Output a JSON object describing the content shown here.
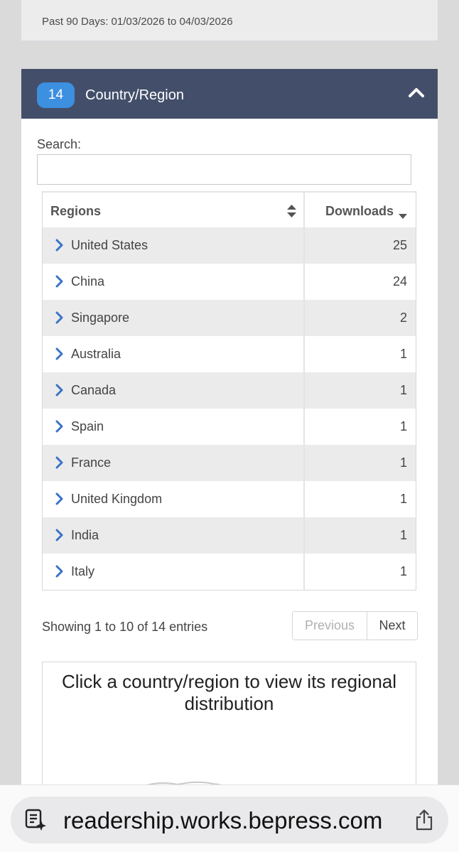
{
  "summary": {
    "date_range": "Past 90 Days: 01/03/2026 to 04/03/2026"
  },
  "panel": {
    "badge_count": "14",
    "title": "Country/Region",
    "collapse_icon": "chevron-up-icon"
  },
  "search": {
    "label": "Search:",
    "value": ""
  },
  "table": {
    "columns": [
      "Regions",
      "Downloads"
    ],
    "sort": {
      "column": "Downloads",
      "direction": "descending"
    },
    "rows": [
      {
        "region": "United States",
        "downloads": "25"
      },
      {
        "region": "China",
        "downloads": "24"
      },
      {
        "region": "Singapore",
        "downloads": "2"
      },
      {
        "region": "Australia",
        "downloads": "1"
      },
      {
        "region": "Canada",
        "downloads": "1"
      },
      {
        "region": "Spain",
        "downloads": "1"
      },
      {
        "region": "France",
        "downloads": "1"
      },
      {
        "region": "United Kingdom",
        "downloads": "1"
      },
      {
        "region": "India",
        "downloads": "1"
      },
      {
        "region": "Italy",
        "downloads": "1"
      }
    ]
  },
  "pagination": {
    "info": "Showing 1 to 10 of 14 entries",
    "previous": "Previous",
    "next": "Next"
  },
  "map": {
    "hint": "Click a country/region to view its regional distribution"
  },
  "browser": {
    "url": "readership.works.bepress.com",
    "reader_icon": "reader-mode-icon",
    "share_icon": "share-icon"
  },
  "colors": {
    "header_bg": "#434f6a",
    "badge_bg": "#3d8fe0",
    "chevron": "#3a73c8",
    "row_stripe": "#ebebeb"
  }
}
